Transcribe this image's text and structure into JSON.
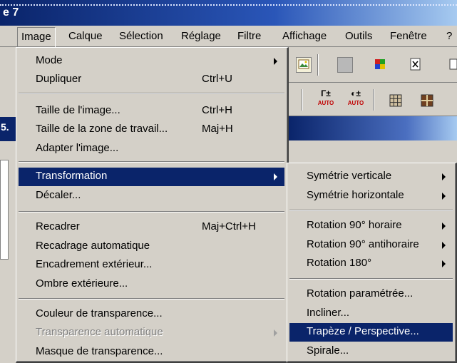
{
  "window": {
    "title": "e 7"
  },
  "menubar": {
    "items": [
      "Image",
      "Calque",
      "Sélection",
      "Réglage",
      "Filtre",
      "Affichage",
      "Outils",
      "Fenêtre",
      "?"
    ]
  },
  "toolbar": {
    "gamma_auto_label": "AUTO",
    "contrast_auto_label": "AUTO",
    "gamma_symbol": "Γ±",
    "contrast_symbol": "◐±"
  },
  "left_strip": {
    "doc_title": "5."
  },
  "image_menu": {
    "items": [
      {
        "label": "Mode",
        "shortcut": "",
        "submenu": true
      },
      {
        "label": "Dupliquer",
        "shortcut": "Ctrl+U"
      },
      {
        "label": "Taille de l'image...",
        "shortcut": "Ctrl+H"
      },
      {
        "label": "Taille de la zone de travail...",
        "shortcut": "Maj+H"
      },
      {
        "label": "Adapter l'image..."
      },
      {
        "label": "Transformation",
        "submenu": true,
        "selected": true
      },
      {
        "label": "Décaler..."
      },
      {
        "label": "Recadrer",
        "shortcut": "Maj+Ctrl+H"
      },
      {
        "label": "Recadrage automatique"
      },
      {
        "label": "Encadrement extérieur..."
      },
      {
        "label": "Ombre extérieure..."
      },
      {
        "label": "Couleur de transparence..."
      },
      {
        "label": "Transparence automatique",
        "disabled": true,
        "submenu": true
      },
      {
        "label": "Masque de transparence..."
      }
    ]
  },
  "transform_submenu": {
    "items": [
      {
        "label": "Symétrie verticale",
        "submenu": true
      },
      {
        "label": "Symétrie horizontale",
        "submenu": true
      },
      {
        "label": "Rotation 90° horaire",
        "submenu": true
      },
      {
        "label": "Rotation 90° antihoraire",
        "submenu": true
      },
      {
        "label": "Rotation 180°",
        "submenu": true
      },
      {
        "label": "Rotation paramétrée..."
      },
      {
        "label": "Incliner..."
      },
      {
        "label": "Trapèze / Perspective...",
        "selected": true
      },
      {
        "label": "Spirale..."
      }
    ]
  },
  "colors": {
    "selection": "#0a246a",
    "menu_bg": "#d4d0c8"
  }
}
